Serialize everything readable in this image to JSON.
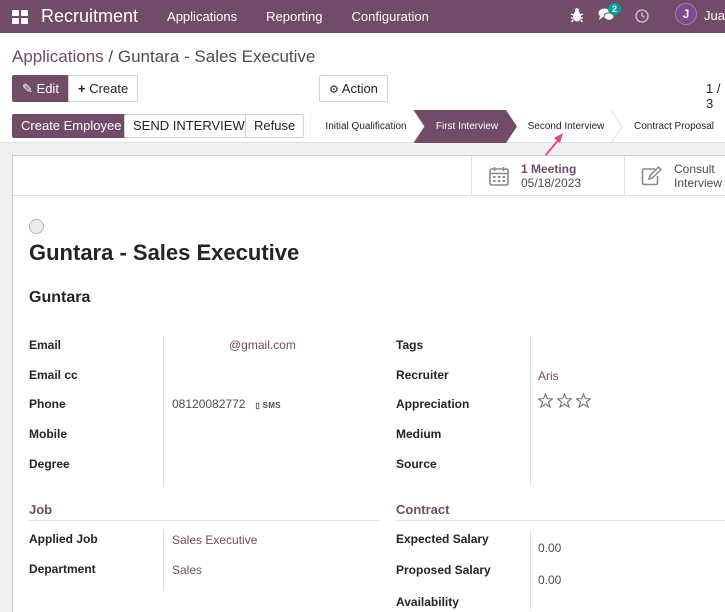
{
  "navbar": {
    "app_name": "Recruitment",
    "menu": [
      "Applications",
      "Reporting",
      "Configuration"
    ],
    "chat_count": "2",
    "avatar_letter": "J",
    "user_name": "Jual"
  },
  "breadcrumb": {
    "parent": "Applications",
    "separator": "/",
    "current": "Guntara - Sales Executive"
  },
  "toolbar": {
    "edit_label": "Edit",
    "create_label": "Create",
    "action_label": "Action",
    "pager": "1 / 3"
  },
  "statusbar": {
    "create_employee_label": "Create Employee",
    "send_interview_label": "SEND INTERVIEW",
    "refuse_label": "Refuse",
    "stages": [
      "Initial Qualification",
      "First Interview",
      "Second Interview",
      "Contract Proposal"
    ],
    "active_stage": "First Interview"
  },
  "smart_buttons": {
    "meeting_label": "1 Meeting",
    "meeting_date": "05/18/2023",
    "consult_line1": "Consult",
    "consult_line2": "Interview"
  },
  "form": {
    "title": "Guntara - Sales Executive",
    "partner_name": "Guntara",
    "left_fields": {
      "email_label": "Email",
      "email_value": "@gmail.com",
      "email_cc_label": "Email cc",
      "phone_label": "Phone",
      "phone_value": "08120082772",
      "sms_label": "SMS",
      "mobile_label": "Mobile",
      "degree_label": "Degree"
    },
    "right_fields": {
      "tags_label": "Tags",
      "recruiter_label": "Recruiter",
      "recruiter_value": "Aris",
      "appreciation_label": "Appreciation",
      "appreciation_stars": 0,
      "appreciation_max": 3,
      "medium_label": "Medium",
      "source_label": "Source"
    },
    "job_section": {
      "title": "Job",
      "applied_job_label": "Applied Job",
      "applied_job_value": "Sales Executive",
      "department_label": "Department",
      "department_value": "Sales"
    },
    "contract_section": {
      "title": "Contract",
      "expected_salary_label": "Expected Salary",
      "expected_salary_value": "0.00",
      "proposed_salary_label": "Proposed Salary",
      "proposed_salary_value": "0.00",
      "availability_label": "Availability"
    }
  },
  "colors": {
    "brand": "#714b67",
    "annotation_arrow": "#e83e8c",
    "chat_badge": "#00a09d"
  }
}
